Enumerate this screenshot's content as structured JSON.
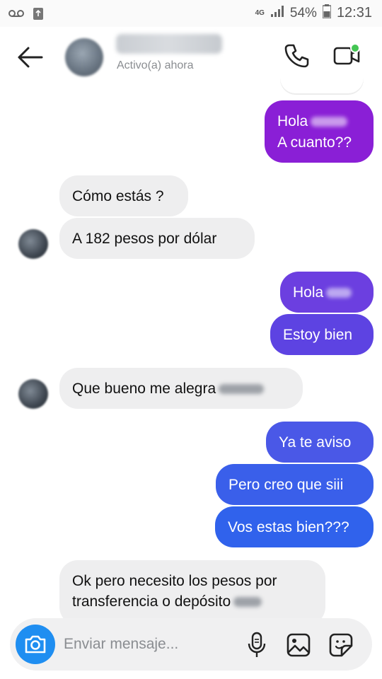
{
  "status_bar": {
    "network": "4G",
    "battery": "54%",
    "time": "12:31",
    "icons": [
      "voicemail-icon",
      "recycle-icon",
      "signal-icon",
      "battery-icon"
    ]
  },
  "header": {
    "contact_status": "Activo(a) ahora",
    "icons": [
      "back-arrow-icon",
      "phone-icon",
      "video-icon"
    ],
    "online_color": "#44c553"
  },
  "messages": {
    "m1": {
      "text": "Hola",
      "text2": "A cuanto??"
    },
    "m2": {
      "text": "Cómo estás ?"
    },
    "m3": {
      "text": "A 182 pesos por  dólar"
    },
    "m4": {
      "text": "Hola"
    },
    "m5": {
      "text": "Estoy bien"
    },
    "m6": {
      "text": "Que bueno me alegra"
    },
    "m7": {
      "text": "Ya te aviso"
    },
    "m8": {
      "text": "Pero creo que siii"
    },
    "m9": {
      "text": "Vos estas bien???"
    },
    "m10": {
      "line1": "Ok pero necesito los pesos por",
      "line2": "transferencia o depósito"
    }
  },
  "colors": {
    "incoming_bubble": "#eeeeef",
    "purple": "#8a1fd6",
    "violet": "#6c3fe0",
    "indigo": "#4d54e6",
    "blue": "#3062ec",
    "camera": "#1f8ef1"
  },
  "composer": {
    "placeholder": "Enviar mensaje...",
    "icons": [
      "camera-icon",
      "microphone-icon",
      "image-icon",
      "sticker-icon"
    ]
  }
}
